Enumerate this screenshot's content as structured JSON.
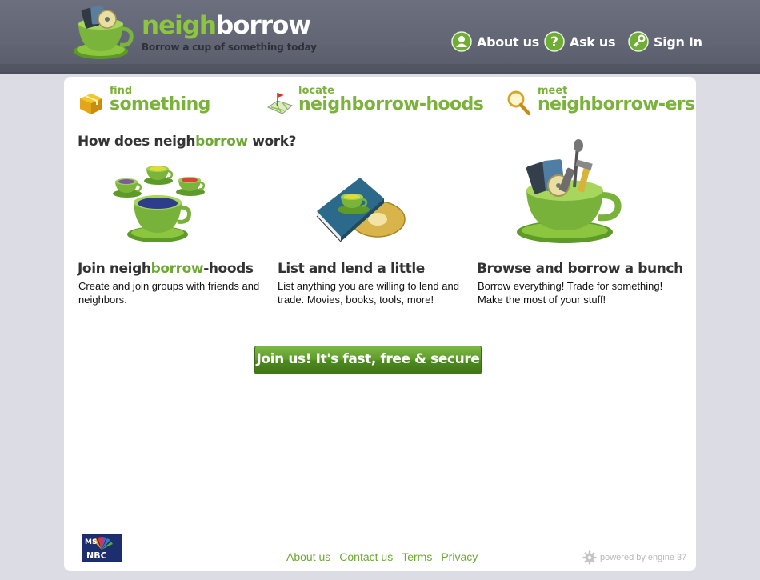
{
  "header": {
    "logo": {
      "part1": "neigh",
      "part2": "borrow"
    },
    "tagline": "Borrow a cup of something today",
    "nav": [
      {
        "label": "About us",
        "icon": "person-icon"
      },
      {
        "label": "Ask us",
        "icon": "question-icon"
      },
      {
        "label": "Sign In",
        "icon": "key-icon"
      }
    ]
  },
  "features": [
    {
      "small": "find",
      "big": "something",
      "icon": "box-icon"
    },
    {
      "small": "locate",
      "big": "neighborrow-hoods",
      "icon": "map-icon"
    },
    {
      "small": "meet",
      "big": "neighborrow-ers",
      "icon": "magnifier-icon"
    }
  ],
  "how": {
    "pre": "How does neigh",
    "highlight": "borrow",
    "post": " work?"
  },
  "columns": [
    {
      "title_pre": "Join neigh",
      "title_highlight": "borrow",
      "title_post": "-hoods",
      "desc": "Create and join groups with friends and neighbors."
    },
    {
      "title": "List and lend a little",
      "desc": "List anything you are willing to lend and trade. Movies, books, tools, more!"
    },
    {
      "title": "Browse and borrow a bunch",
      "desc": "Borrow everything! Trade for something! Make the most of your stuff!"
    }
  ],
  "cta": {
    "label": "Join us! It's fast, free & secure"
  },
  "footer": {
    "partner_logo": "MSNBC",
    "links": [
      "About us",
      "Contact us",
      "Terms",
      "Privacy"
    ],
    "powered": "powered by engine 37"
  },
  "colors": {
    "brand_green": "#7bb23a",
    "header_bg": "#626674",
    "page_bg": "#dcdce4"
  }
}
